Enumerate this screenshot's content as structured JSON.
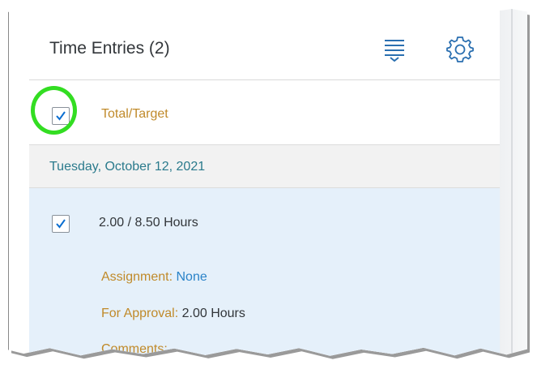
{
  "header": {
    "title": "Time Entries (2)",
    "sort_icon": "sort-lines-icon",
    "settings_icon": "gear-icon"
  },
  "total_row": {
    "checked": true,
    "label": "Total/Target"
  },
  "group": {
    "date_label": "Tuesday, October 12, 2021"
  },
  "entry": {
    "checked": true,
    "hours": "2.00 / 8.50 Hours",
    "fields": {
      "assignment_label": "Assignment:",
      "assignment_value": "None",
      "approval_label": "For Approval:",
      "approval_value": "2.00 Hours",
      "comments_label": "Comments:"
    }
  },
  "colors": {
    "accent_label": "#c08a2a",
    "link": "#2a83c8",
    "group_text": "#2a7a8c",
    "selected_row": "#e5f0fa",
    "highlight_ring": "#33dd22",
    "check": "#0a6ed1"
  }
}
